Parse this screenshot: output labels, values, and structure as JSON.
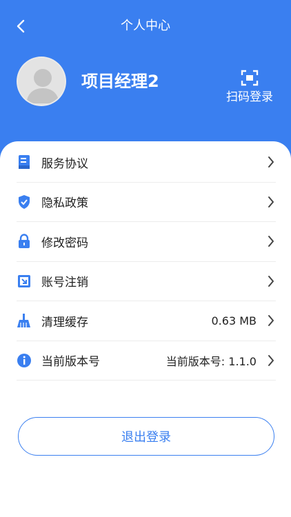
{
  "header": {
    "title": "个人中心",
    "username": "项目经理2",
    "scan_label": "扫码登录"
  },
  "menu": [
    {
      "label": "服务协议",
      "value": "",
      "icon": "document-icon"
    },
    {
      "label": "隐私政策",
      "value": "",
      "icon": "shield-icon"
    },
    {
      "label": "修改密码",
      "value": "",
      "icon": "lock-icon"
    },
    {
      "label": "账号注销",
      "value": "",
      "icon": "account-cancel-icon"
    },
    {
      "label": "清理缓存",
      "value": "0.63 MB",
      "icon": "broom-icon"
    },
    {
      "label": "当前版本号",
      "value": "当前版本号: 1.1.0",
      "icon": "info-icon"
    }
  ],
  "logout_label": "退出登录",
  "colors": {
    "accent": "#3a7ff0",
    "text": "#222222",
    "divider": "#ececec"
  }
}
